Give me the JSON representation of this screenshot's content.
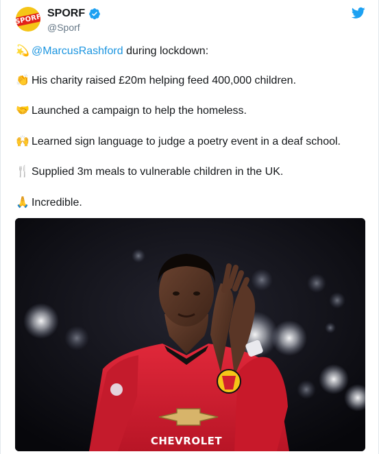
{
  "tweet": {
    "author": {
      "name": "SPORF",
      "handle": "@Sporf",
      "avatar_text": "SPORF",
      "verified": true
    },
    "lines": [
      {
        "emoji_icon": "dizzy-star-icon",
        "emoji": "💫",
        "mention": "@MarcusRashford",
        "text": " during lockdown:"
      },
      {
        "emoji_icon": "clapping-hands-icon",
        "emoji": "👏",
        "text": "His charity raised £20m helping feed 400,000 children."
      },
      {
        "emoji_icon": "handshake-icon",
        "emoji": "🤝",
        "text": "Launched a campaign to help the homeless."
      },
      {
        "emoji_icon": "raising-hands-icon",
        "emoji": "🙌",
        "text": "Learned sign language to judge a poetry event in a deaf school."
      },
      {
        "emoji_icon": "fork-knife-icon",
        "emoji": "🍴",
        "text": "Supplied 3m meals to vulnerable children in the UK."
      },
      {
        "emoji_icon": "folded-hands-icon",
        "emoji": "🙏",
        "text": "Incredible."
      }
    ],
    "media": {
      "shirt_sponsor": "CHEVROLET"
    }
  },
  "colors": {
    "link": "#1b95e0",
    "verified": "#1da1f2",
    "twitter_brand": "#1da1f2",
    "shirt_red": "#d21f2d"
  }
}
